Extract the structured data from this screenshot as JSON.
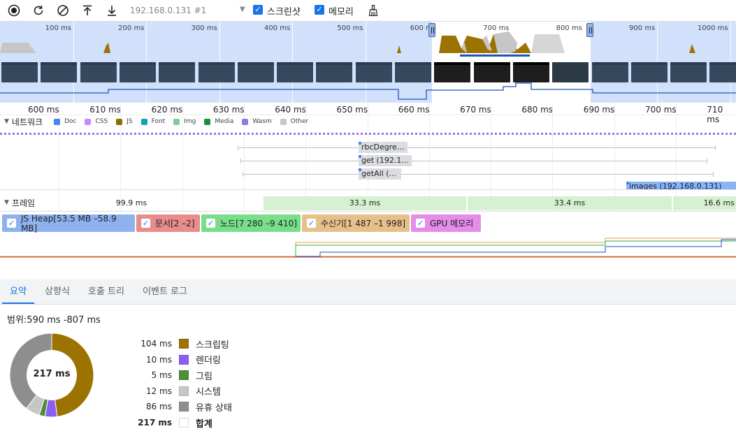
{
  "toolbar": {
    "record_tooltip": "record",
    "target_label": "192.168.0.131 #1",
    "screenshots_label": "스크린샷",
    "memory_label": "메모리",
    "screenshots_checked": true,
    "memory_checked": true
  },
  "overview": {
    "ticks": [
      "100 ms",
      "200 ms",
      "300 ms",
      "400 ms",
      "500 ms",
      "600 ms",
      "700 ms",
      "800 ms",
      "900 ms",
      "1000 ms"
    ]
  },
  "ruler": {
    "ticks": [
      "600 ms",
      "610 ms",
      "620 ms",
      "630 ms",
      "640 ms",
      "650 ms",
      "660 ms",
      "670 ms",
      "680 ms",
      "690 ms",
      "700 ms",
      "710 ms"
    ]
  },
  "network": {
    "title": "네트워크",
    "legend": [
      {
        "label": "Doc",
        "color": "#4285f4"
      },
      {
        "label": "CSS",
        "color": "#c58af9"
      },
      {
        "label": "JS",
        "color": "#8a6e00"
      },
      {
        "label": "Font",
        "color": "#12a4b6"
      },
      {
        "label": "Img",
        "color": "#81c995"
      },
      {
        "label": "Media",
        "color": "#1e8e3e"
      },
      {
        "label": "Wasm",
        "color": "#9179e9"
      },
      {
        "label": "Other",
        "color": "#c8c8c8"
      }
    ],
    "requests": [
      "rbcDegre...",
      "get (192.1...",
      "getAll (...",
      "images (192.168.0.131)"
    ]
  },
  "frames": {
    "title": "프레임",
    "items": [
      "99.9 ms",
      "33.3 ms",
      "33.4 ms",
      "16.6 ms"
    ]
  },
  "memory": {
    "counters": [
      {
        "label": "JS Heap[53.5 MB –58.9 MB]",
        "color": "#8fb1ee"
      },
      {
        "label": "문서[2 –2]",
        "color": "#e88c8c"
      },
      {
        "label": "노드[7 280 –9 410]",
        "color": "#79de8a"
      },
      {
        "label": "수신기[1 487 –1 998]",
        "color": "#e6c089"
      },
      {
        "label": "GPU 메모리",
        "color": "#e58de9"
      }
    ]
  },
  "tabs": [
    "요약",
    "상향식",
    "호출 트리",
    "이벤트 로그"
  ],
  "summary": {
    "range": "범위:590 ms -807 ms",
    "total_center": "217 ms",
    "rows": [
      {
        "ms": "104 ms",
        "name": "스크립팅",
        "color": "#9c7200",
        "value": 104
      },
      {
        "ms": "10 ms",
        "name": "렌더링",
        "color": "#8c5ef0",
        "value": 10
      },
      {
        "ms": "5 ms",
        "name": "그림",
        "color": "#4f8f3a",
        "value": 5
      },
      {
        "ms": "12 ms",
        "name": "시스템",
        "color": "#c6c6c6",
        "value": 12
      },
      {
        "ms": "86 ms",
        "name": "유휴 상태",
        "color": "#8e8e8e",
        "value": 86
      },
      {
        "ms": "217 ms",
        "name": "합계",
        "color": "#ffffff",
        "value": 0
      }
    ]
  }
}
